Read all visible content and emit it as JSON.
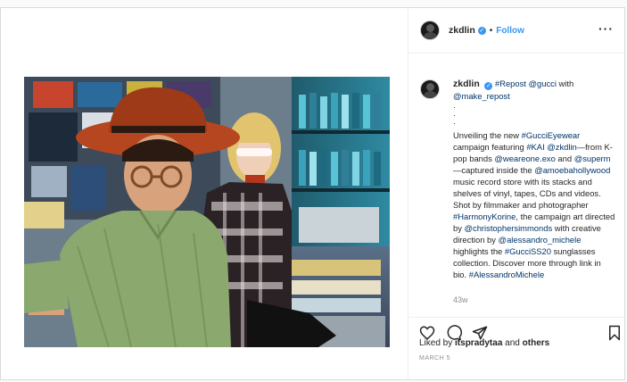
{
  "header": {
    "username": "zkdlin",
    "verified_glyph": "✓",
    "separator": "•",
    "follow_label": "Follow",
    "more_glyph": "···"
  },
  "caption": {
    "username": "zkdlin",
    "line1_link": "#Repost @gucci",
    "line1_rest": " with",
    "line2_link": "@make_repost",
    "dots": "·\n·\n·",
    "segments": [
      {
        "text": "Unveiling the new ",
        "link": false
      },
      {
        "text": "#GucciEyewear",
        "link": true
      },
      {
        "text": " campaign featuring ",
        "link": false
      },
      {
        "text": "#KAI",
        "link": true
      },
      {
        "text": " ",
        "link": false
      },
      {
        "text": "@zkdlin",
        "link": true
      },
      {
        "text": "—from K-pop bands ",
        "link": false
      },
      {
        "text": "@weareone.exo",
        "link": true
      },
      {
        "text": " and ",
        "link": false
      },
      {
        "text": "@superm",
        "link": true
      },
      {
        "text": "—captured inside the ",
        "link": false
      },
      {
        "text": "@amoebahollywood",
        "link": true
      },
      {
        "text": " music record store with its stacks and shelves of vinyl, tapes, CDs and videos. Shot by filmmaker and photographer ",
        "link": false
      },
      {
        "text": "#HarmonyKorine",
        "link": true
      },
      {
        "text": ", the campaign art directed by ",
        "link": false
      },
      {
        "text": "@christophersimmonds",
        "link": true
      },
      {
        "text": " with creative direction by ",
        "link": false
      },
      {
        "text": "@alessandro_michele",
        "link": true
      },
      {
        "text": " highlights the ",
        "link": false
      },
      {
        "text": "#GucciSS20",
        "link": true
      },
      {
        "text": " sunglasses collection. Discover more through link in bio. ",
        "link": false
      },
      {
        "text": "#AlessandroMichele",
        "link": true
      }
    ],
    "time": "43w"
  },
  "actions": {
    "like_icon": "heart-icon",
    "comment_icon": "comment-icon",
    "share_icon": "share-icon",
    "save_icon": "bookmark-icon"
  },
  "likes": {
    "prefix": "Liked by ",
    "user": "itspradytaa",
    "middle": " and ",
    "others": "others"
  },
  "date": "MARCH 5",
  "colors": {
    "link": "#003569",
    "accent": "#3897f0",
    "muted": "#8e8e8e",
    "border": "#dbdbdb"
  }
}
